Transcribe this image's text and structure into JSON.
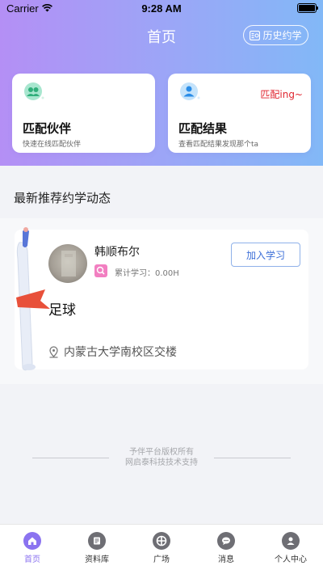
{
  "status": {
    "carrier": "Carrier",
    "time": "9:28 AM"
  },
  "header": {
    "title": "首页",
    "history_label": "历史约学"
  },
  "cards": [
    {
      "title": "匹配伙伴",
      "subtitle": "快速在线匹配伙伴",
      "tag": ""
    },
    {
      "title": "匹配结果",
      "subtitle": "查看匹配结果发现那个ta",
      "tag": "匹配ing~"
    }
  ],
  "section": {
    "title": "最新推荐约学动态"
  },
  "post": {
    "user_name": "韩顺布尔",
    "study_label": "累计学习：0.00H",
    "join_label": "加入学习",
    "title": "足球",
    "location": "内蒙古大学南校区交楼"
  },
  "footer": {
    "line1": "予伴平台版权所有",
    "line2": "网启泰科技技术支持"
  },
  "tabs": [
    {
      "label": "首页",
      "icon": "home-icon",
      "active": true
    },
    {
      "label": "资料库",
      "icon": "book-icon",
      "active": false
    },
    {
      "label": "广场",
      "icon": "plaza-icon",
      "active": false
    },
    {
      "label": "消息",
      "icon": "message-icon",
      "active": false
    },
    {
      "label": "个人中心",
      "icon": "user-icon",
      "active": false
    }
  ],
  "colors": {
    "accent": "#8b73f0",
    "header_start": "#b48ff5",
    "header_end": "#82b8f7",
    "tag_red": "#e0252f",
    "join_blue": "#3c6fd8"
  }
}
